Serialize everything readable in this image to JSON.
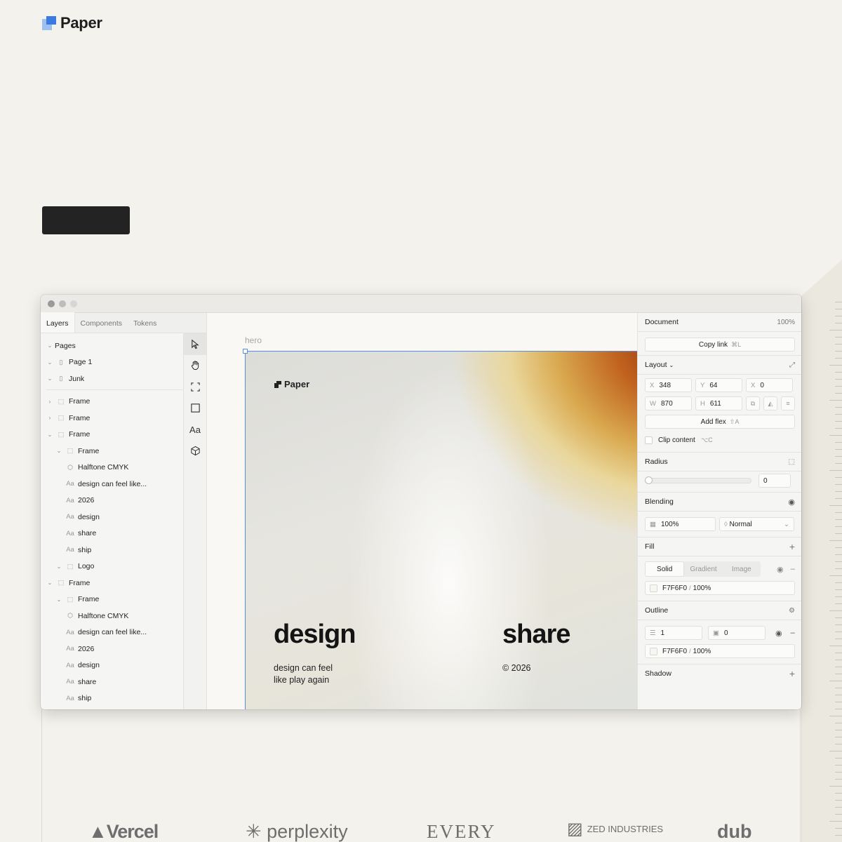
{
  "site": {
    "logo_text": "Paper"
  },
  "app": {
    "tabs": [
      "Layers",
      "Components",
      "Tokens"
    ],
    "layers": [
      {
        "label": "Pages",
        "depth": 0,
        "chev": "v",
        "icon": ""
      },
      {
        "label": "Page 1",
        "depth": 0,
        "chev": "v",
        "icon": "page"
      },
      {
        "label": "Junk",
        "depth": 0,
        "chev": "v",
        "icon": "page"
      },
      {
        "sep": true
      },
      {
        "label": "Frame",
        "depth": 0,
        "chev": ">",
        "icon": "frame"
      },
      {
        "label": "Frame",
        "depth": 0,
        "chev": ">",
        "icon": "frame"
      },
      {
        "label": "Frame",
        "depth": 0,
        "chev": "v",
        "icon": "frame"
      },
      {
        "label": "Frame",
        "depth": 1,
        "chev": "v",
        "icon": "frame"
      },
      {
        "label": "Halftone CMYK",
        "depth": 1,
        "chev": "",
        "icon": "shader"
      },
      {
        "label": "design can feel like...",
        "depth": 1,
        "chev": "",
        "icon": "text"
      },
      {
        "label": "2026",
        "depth": 1,
        "chev": "",
        "icon": "text"
      },
      {
        "label": "design",
        "depth": 1,
        "chev": "",
        "icon": "text"
      },
      {
        "label": "share",
        "depth": 1,
        "chev": "",
        "icon": "text"
      },
      {
        "label": "ship",
        "depth": 1,
        "chev": "",
        "icon": "text"
      },
      {
        "label": "Logo",
        "depth": 1,
        "chev": "v",
        "icon": "frame"
      },
      {
        "label": "Frame",
        "depth": 0,
        "chev": "v",
        "icon": "frame"
      },
      {
        "label": "Frame",
        "depth": 1,
        "chev": "v",
        "icon": "frame"
      },
      {
        "label": "Halftone CMYK",
        "depth": 1,
        "chev": "",
        "icon": "shader"
      },
      {
        "label": "design can feel like...",
        "depth": 1,
        "chev": "",
        "icon": "text"
      },
      {
        "label": "2026",
        "depth": 1,
        "chev": "",
        "icon": "text"
      },
      {
        "label": "design",
        "depth": 1,
        "chev": "",
        "icon": "text"
      },
      {
        "label": "share",
        "depth": 1,
        "chev": "",
        "icon": "text"
      },
      {
        "label": "ship",
        "depth": 1,
        "chev": "",
        "icon": "text"
      }
    ],
    "text_icon_glyph": "Aa",
    "tools": [
      "pointer-icon",
      "hand-icon",
      "frame-tool-icon",
      "rectangle-icon",
      "text-tool-icon",
      "cube-icon"
    ],
    "text_tool_label": "Aa",
    "canvas": {
      "frame_label": "hero",
      "hero_logo": "Paper",
      "headline_left": "design",
      "subtext_left_line1": "design can feel",
      "subtext_left_line2": "like play again",
      "headline_right": "share",
      "subtext_right": "© 2026"
    },
    "inspector": {
      "document_label": "Document",
      "zoom": "100%",
      "copy_link": "Copy link",
      "copy_link_kbd": "⌘L",
      "layout_label": "Layout",
      "x_label": "X",
      "x_value": "348",
      "y_label": "Y",
      "y_value": "64",
      "rot_label": "X",
      "rot_value": "0",
      "w_label": "W",
      "w_value": "870",
      "h_label": "H",
      "h_value": "611",
      "add_flex": "Add flex",
      "add_flex_kbd": "⇧A",
      "clip_content": "Clip content",
      "clip_kbd": "⌥C",
      "radius_label": "Radius",
      "radius_value": "0",
      "blending_label": "Blending",
      "opacity": "100%",
      "blend_mode": "Normal",
      "fill_label": "Fill",
      "fill_tabs": [
        "Solid",
        "Gradient",
        "Image"
      ],
      "fill_hex": "F7F6F0",
      "fill_sep": "/",
      "fill_opacity": "100%",
      "outline_label": "Outline",
      "outline_width": "1",
      "outline_offset": "0",
      "outline_hex": "F7F6F0",
      "outline_opacity": "100%",
      "shadow_label": "Shadow"
    }
  },
  "brands": [
    "Vercel",
    "perplexity",
    "EVERY",
    "ZED INDUSTRIES",
    "dub"
  ],
  "colors": {
    "background": "#f4f2ec",
    "selection": "#5a8de0",
    "brand_blue": "#3b7ae0",
    "dark_button": "#232323"
  }
}
